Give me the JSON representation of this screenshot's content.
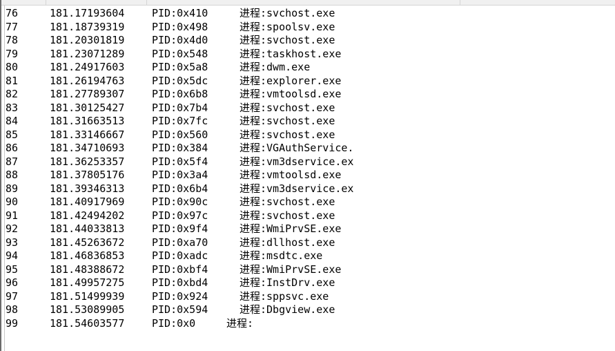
{
  "rows": [
    {
      "num": "76",
      "time": "181.17193604",
      "pid": "PID:0x410",
      "process": "进程:svchost.exe"
    },
    {
      "num": "77",
      "time": "181.18739319",
      "pid": "PID:0x498",
      "process": "进程:spoolsv.exe"
    },
    {
      "num": "78",
      "time": "181.20301819",
      "pid": "PID:0x4d0",
      "process": "进程:svchost.exe"
    },
    {
      "num": "79",
      "time": "181.23071289",
      "pid": "PID:0x548",
      "process": "进程:taskhost.exe"
    },
    {
      "num": "80",
      "time": "181.24917603",
      "pid": "PID:0x5a8",
      "process": "进程:dwm.exe"
    },
    {
      "num": "81",
      "time": "181.26194763",
      "pid": "PID:0x5dc",
      "process": "进程:explorer.exe"
    },
    {
      "num": "82",
      "time": "181.27789307",
      "pid": "PID:0x6b8",
      "process": "进程:vmtoolsd.exe"
    },
    {
      "num": "83",
      "time": "181.30125427",
      "pid": "PID:0x7b4",
      "process": "进程:svchost.exe"
    },
    {
      "num": "84",
      "time": "181.31663513",
      "pid": "PID:0x7fc",
      "process": "进程:svchost.exe"
    },
    {
      "num": "85",
      "time": "181.33146667",
      "pid": "PID:0x560",
      "process": "进程:svchost.exe"
    },
    {
      "num": "86",
      "time": "181.34710693",
      "pid": "PID:0x384",
      "process": "进程:VGAuthService."
    },
    {
      "num": "87",
      "time": "181.36253357",
      "pid": "PID:0x5f4",
      "process": "进程:vm3dservice.ex"
    },
    {
      "num": "88",
      "time": "181.37805176",
      "pid": "PID:0x3a4",
      "process": "进程:vmtoolsd.exe"
    },
    {
      "num": "89",
      "time": "181.39346313",
      "pid": "PID:0x6b4",
      "process": "进程:vm3dservice.ex"
    },
    {
      "num": "90",
      "time": "181.40917969",
      "pid": "PID:0x90c",
      "process": "进程:svchost.exe"
    },
    {
      "num": "91",
      "time": "181.42494202",
      "pid": "PID:0x97c",
      "process": "进程:svchost.exe"
    },
    {
      "num": "92",
      "time": "181.44033813",
      "pid": "PID:0x9f4",
      "process": "进程:WmiPrvSE.exe"
    },
    {
      "num": "93",
      "time": "181.45263672",
      "pid": "PID:0xa70",
      "process": "进程:dllhost.exe"
    },
    {
      "num": "94",
      "time": "181.46836853",
      "pid": "PID:0xadc",
      "process": "进程:msdtc.exe"
    },
    {
      "num": "95",
      "time": "181.48388672",
      "pid": "PID:0xbf4",
      "process": "进程:WmiPrvSE.exe"
    },
    {
      "num": "96",
      "time": "181.49957275",
      "pid": "PID:0xbd4",
      "process": "进程:InstDrv.exe"
    },
    {
      "num": "97",
      "time": "181.51499939",
      "pid": "PID:0x924",
      "process": "进程:sppsvc.exe"
    },
    {
      "num": "98",
      "time": "181.53089905",
      "pid": "PID:0x594",
      "process": "进程:Dbgview.exe"
    },
    {
      "num": "99",
      "time": "181.54603577",
      "pid": "PID:0x0",
      "process": "进程:"
    }
  ]
}
